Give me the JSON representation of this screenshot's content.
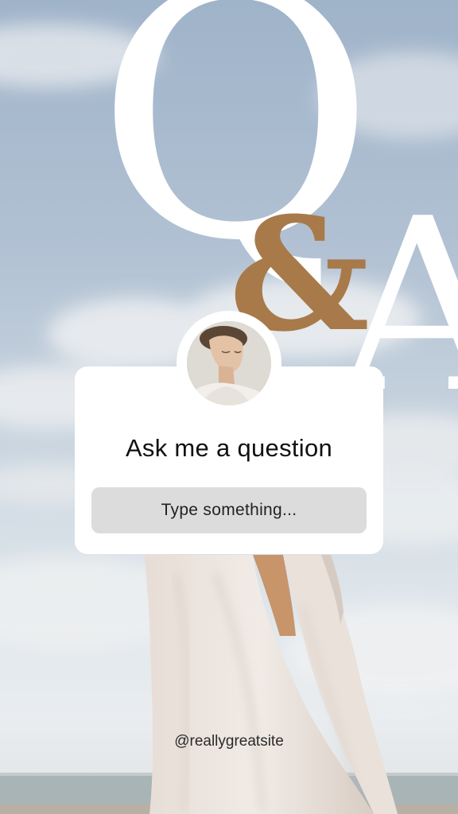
{
  "story": {
    "headline": {
      "q": "Q",
      "amp": "&",
      "a": "A"
    },
    "question_prompt": "Ask me a question",
    "reply_placeholder": "Type something...",
    "handle": "@reallygreatsite"
  },
  "colors": {
    "sky_top": "#9fb3c9",
    "sky_bottom": "#e9edf0",
    "headline": "#ffffff",
    "ampersand": "#a87a4a",
    "card": "#ffffff",
    "field": "#dcdcdc",
    "text": "#111111"
  },
  "icons": {
    "avatar": "profile-photo"
  }
}
